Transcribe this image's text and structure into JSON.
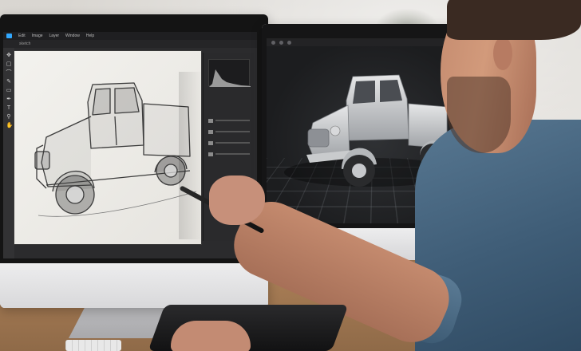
{
  "scene": {
    "description_key": "designer-at-dual-monitors"
  },
  "left_monitor": {
    "menu_items": [
      "Edit",
      "Image",
      "Layer",
      "Window",
      "Help"
    ],
    "tab_label": "sketch"
  },
  "right_monitor": {
    "window_dots": [
      "dot",
      "dot",
      "dot"
    ]
  },
  "icons": {
    "tools": [
      "move-icon",
      "marquee-icon",
      "lasso-icon",
      "brush-icon",
      "eraser-icon",
      "pen-icon",
      "text-icon",
      "zoom-icon",
      "hand-icon"
    ]
  },
  "colors": {
    "app_accent": "#31a8ff",
    "shirt": "#3f5d77",
    "desk": "#a47a53"
  }
}
